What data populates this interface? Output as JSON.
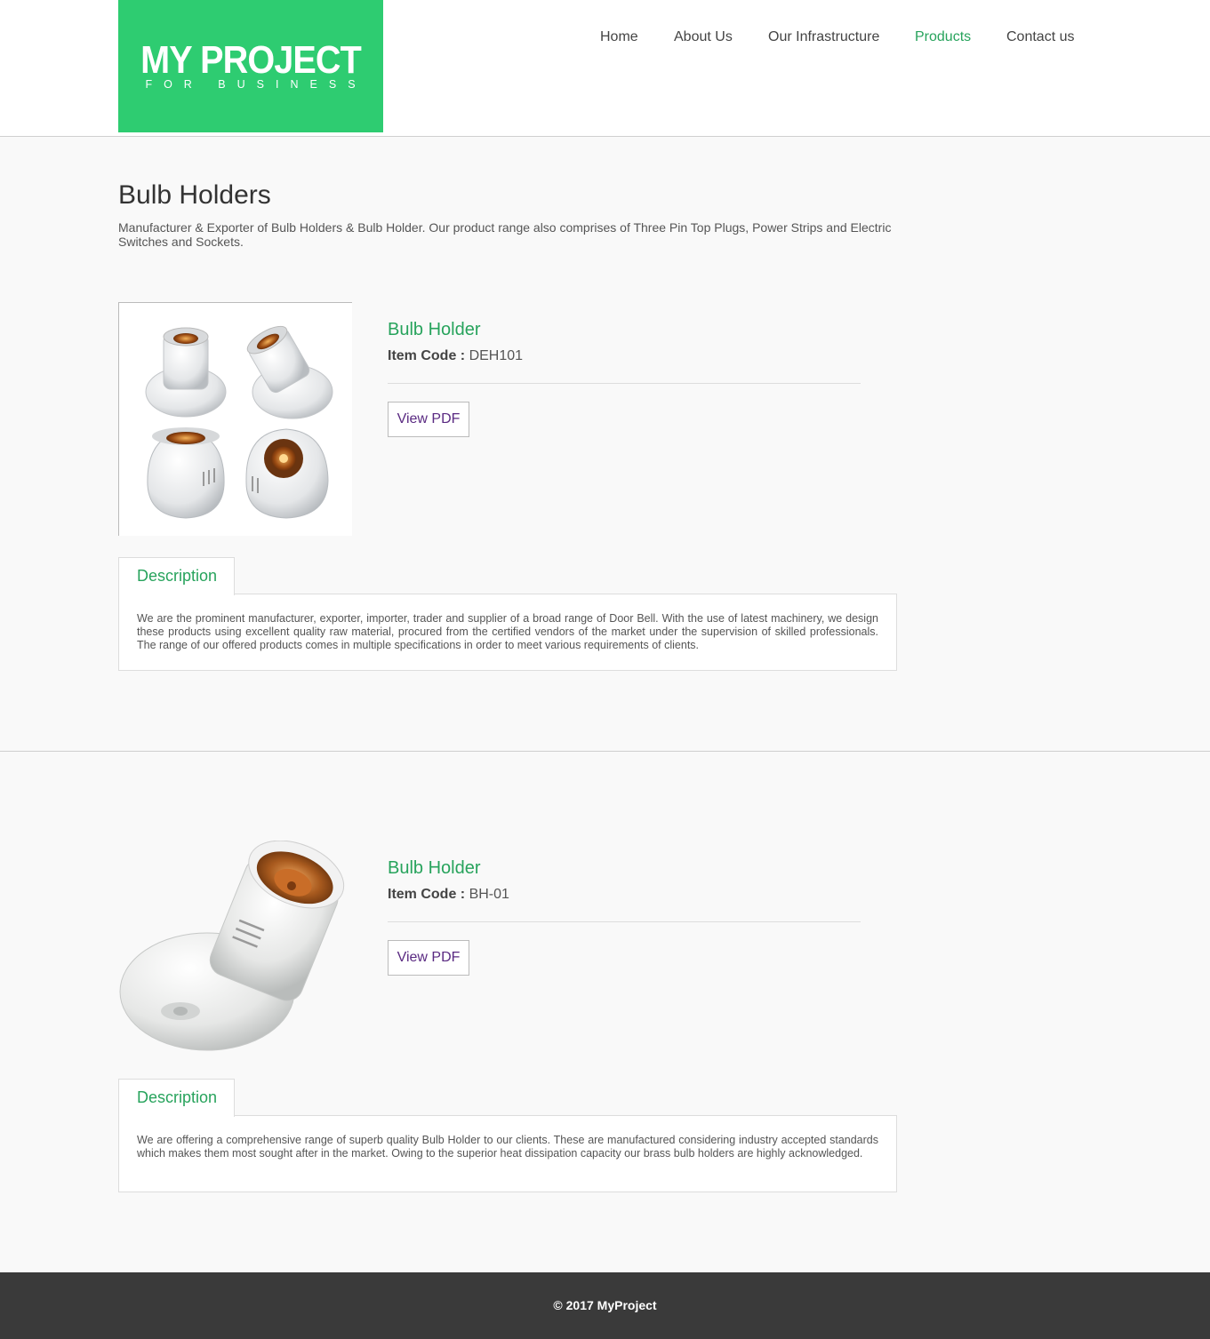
{
  "header": {
    "logo_title": "MY PROJECT",
    "logo_subtitle": "FOR BUSINESS",
    "nav": [
      {
        "label": "Home"
      },
      {
        "label": "About Us"
      },
      {
        "label": "Our Infrastructure"
      },
      {
        "label": "Products",
        "active": true
      },
      {
        "label": "Contact us"
      }
    ]
  },
  "main": {
    "title": "Bulb Holders",
    "intro": "Manufacturer & Exporter of Bulb Holders & Bulb Holder. Our product range also comprises of Three Pin Top Plugs, Power Strips and Electric Switches and Sockets."
  },
  "products": [
    {
      "name": "Bulb Holder",
      "code_label": "Item Code :",
      "code": "DEH101",
      "button": "View PDF",
      "tab": "Description",
      "description": "We are the prominent manufacturer, exporter, importer, trader and supplier of a broad range of Door Bell. With the use of latest machinery, we design these products using excellent quality raw material, procured from the certified vendors of the market under the supervision of skilled professionals. The range of our offered products comes in multiple specifications in order to meet various requirements of clients."
    },
    {
      "name": "Bulb Holder",
      "code_label": "Item Code :",
      "code": "BH-01",
      "button": "View PDF",
      "tab": "Description",
      "description": "We are offering a comprehensive range of superb quality Bulb Holder to our clients. These are manufactured considering industry accepted standards which makes them most sought after in the market. Owing to the superior heat dissipation capacity our brass bulb holders are highly acknowledged."
    }
  ],
  "footer": {
    "copyright": "© 2017 MyProject"
  },
  "colors": {
    "brand_green": "#2ecc71",
    "link_green": "#27a35c",
    "footer_bg": "#3a3a3a",
    "pdf_link": "#5a2a82"
  }
}
